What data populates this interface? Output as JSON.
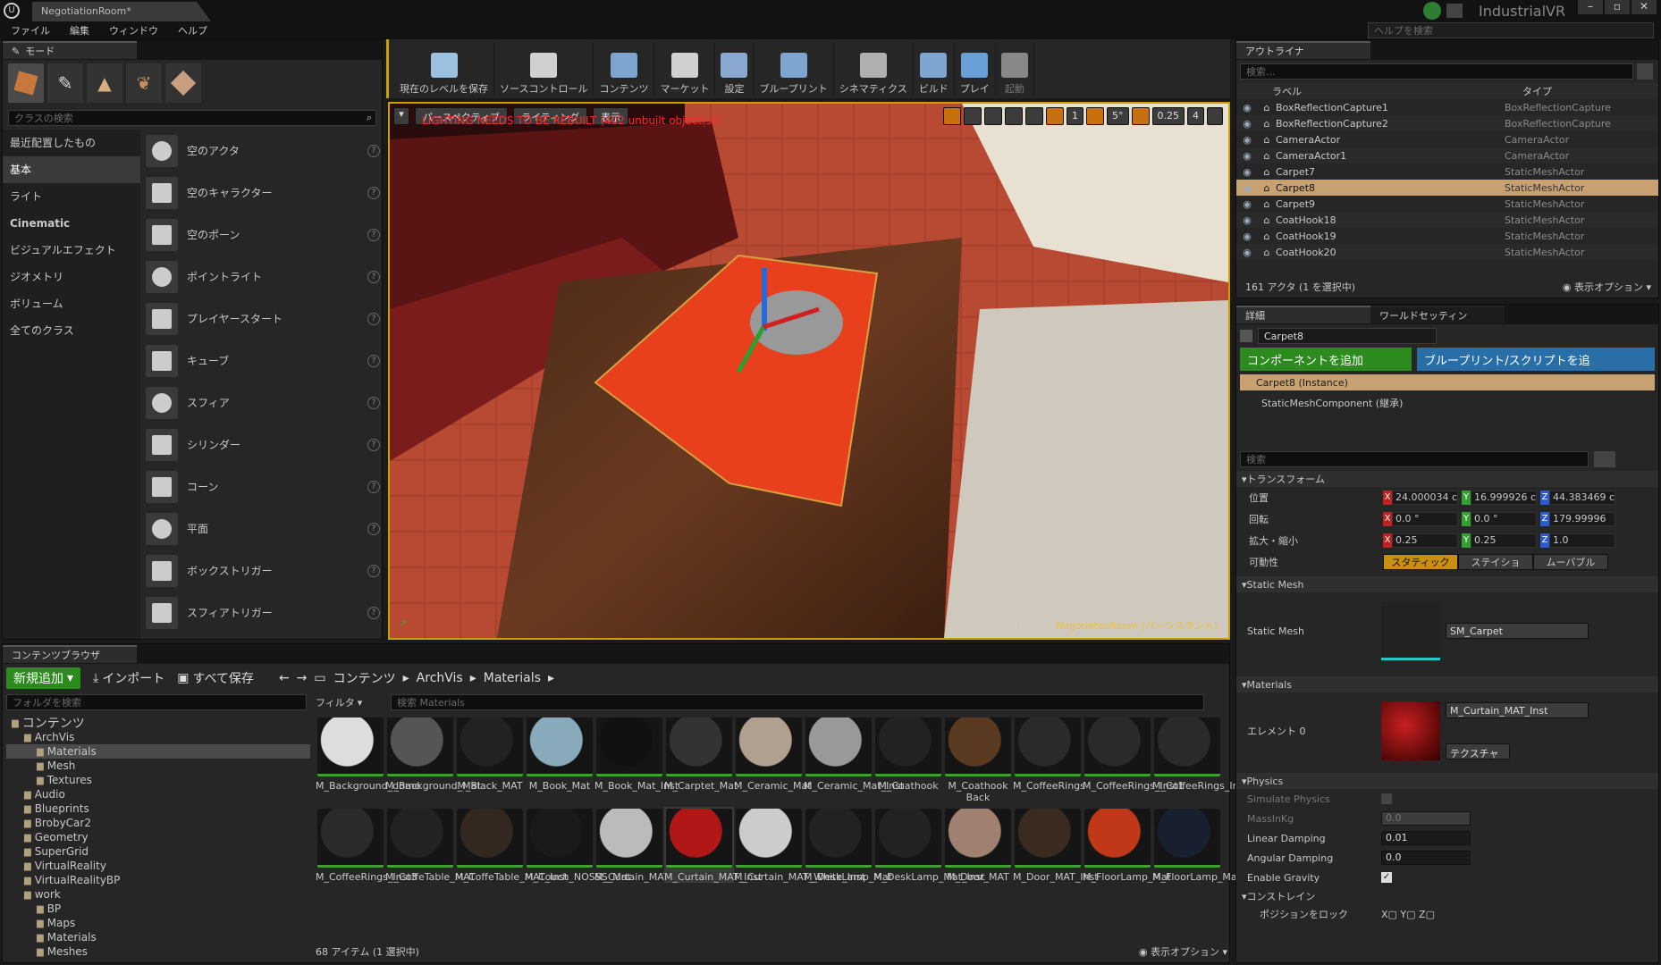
{
  "app": {
    "tab_title": "NegotiationRoom*",
    "brand": "IndustrialVR",
    "help_search_placeholder": "ヘルプを検索"
  },
  "menu": [
    "ファイル",
    "編集",
    "ウィンドウ",
    "ヘルプ"
  ],
  "modes": {
    "tab": "モード",
    "search_placeholder": "クラスの検索",
    "categories": [
      "最近配置したもの",
      "基本",
      "ライト",
      "Cinematic",
      "ビジュアルエフェクト",
      "ジオメトリ",
      "ボリューム",
      "全てのクラス"
    ],
    "selected_category": "基本",
    "items": [
      "空のアクタ",
      "空のキャラクター",
      "空のポーン",
      "ポイントライト",
      "プレイヤースタート",
      "キューブ",
      "スフィア",
      "シリンダー",
      "コーン",
      "平面",
      "ボックストリガー",
      "スフィアトリガー"
    ]
  },
  "toolbar": {
    "buttons": [
      "現在のレベルを保存",
      "ソースコントロール",
      "コンテンツ",
      "マーケット",
      "設定",
      "ブループリント",
      "シネマティクス",
      "ビルド",
      "プレイ",
      "起動"
    ]
  },
  "viewport": {
    "perspective": "パースペクティブ",
    "lighting": "ライティング",
    "show": "表示",
    "warning": "LIGHTING NEEDS TO BE REBUILT (402 unbuilt object(s))",
    "grid": "1",
    "angle": "5°",
    "scale": "0.25",
    "camera_speed": "4",
    "level_label": "レベル：",
    "level_name": "NegotiatonRoom (パーシスタント)"
  },
  "content_browser": {
    "tab": "コンテンツブラウザ",
    "add_new": "新規追加",
    "import": "インポート",
    "save_all": "すべて保存",
    "path": [
      "コンテンツ",
      "ArchVis",
      "Materials"
    ],
    "folder_search_placeholder": "フォルダを検索",
    "filter": "フィルタ",
    "asset_search_placeholder": "検索 Materials",
    "tree": [
      {
        "label": "コンテンツ",
        "level": 0,
        "root": true
      },
      {
        "label": "ArchVis",
        "level": 1
      },
      {
        "label": "Materials",
        "level": 2,
        "selected": true
      },
      {
        "label": "Mesh",
        "level": 2
      },
      {
        "label": "Textures",
        "level": 2
      },
      {
        "label": "Audio",
        "level": 1
      },
      {
        "label": "Blueprints",
        "level": 1
      },
      {
        "label": "BrobyCar2",
        "level": 1
      },
      {
        "label": "Geometry",
        "level": 1
      },
      {
        "label": "SuperGrid",
        "level": 1
      },
      {
        "label": "VirtualReality",
        "level": 1
      },
      {
        "label": "VirtualRealityBP",
        "level": 1
      },
      {
        "label": "work",
        "level": 1
      },
      {
        "label": "BP",
        "level": 2
      },
      {
        "label": "Maps",
        "level": 2
      },
      {
        "label": "Materials",
        "level": 2
      },
      {
        "label": "Meshes",
        "level": 2
      }
    ],
    "assets_row1": [
      "M_Background_dome",
      "M_Background_Mat",
      "M_Black_MAT",
      "M_Book_Mat",
      "M_Book_Mat_Inst",
      "M_Carptet_Mat",
      "M_Ceramic_Mat",
      "M_Ceramic_Mat_Inst",
      "M_Coathook",
      "M_Coathook Back",
      "M_CoffeeRings",
      "M_CoffeeRings_Inst1",
      "M_CoffeeRings_Inst2"
    ],
    "assets_row2": [
      "M_CoffeeRings_Inst3",
      "M_CoffeTable_MAT",
      "M_CoffeTable_MAT_Inst",
      "M_Couch_NOSSS_Mat",
      "M_Curtain_MAT",
      "M_Curtain_MAT_Inst",
      "M_Curtain_MAT_White_Inst",
      "M_DeskLamp_Mat",
      "M_DeskLamp_Mat_Inst",
      "M_Door_MAT",
      "M_Door_MAT_Inst",
      "M_FloorLamp_Mat",
      "M_FloorLamp_Mat_Inst"
    ],
    "selected_asset": "M_Curtain_MAT_Inst",
    "status": "68 アイテム (1 選択中)",
    "view_options": "表示オプション"
  },
  "outliner": {
    "tab": "アウトライナ",
    "search_placeholder": "検索...",
    "col_label": "ラベル",
    "col_type": "タイプ",
    "rows": [
      {
        "label": "BoxReflectionCapture1",
        "type": "BoxReflectionCapture"
      },
      {
        "label": "BoxReflectionCapture2",
        "type": "BoxReflectionCapture"
      },
      {
        "label": "CameraActor",
        "type": "CameraActor"
      },
      {
        "label": "CameraActor1",
        "type": "CameraActor"
      },
      {
        "label": "Carpet7",
        "type": "StaticMeshActor"
      },
      {
        "label": "Carpet8",
        "type": "StaticMeshActor",
        "selected": true
      },
      {
        "label": "Carpet9",
        "type": "StaticMeshActor"
      },
      {
        "label": "CoatHook18",
        "type": "StaticMeshActor"
      },
      {
        "label": "CoatHook19",
        "type": "StaticMeshActor"
      },
      {
        "label": "CoatHook20",
        "type": "StaticMeshActor"
      }
    ],
    "status": "161 アクタ (1 を選択中)",
    "view_options": "表示オプション"
  },
  "details": {
    "tab": "詳細",
    "tab2": "ワールドセッティン",
    "name": "Carpet8",
    "add_component": "コンポーネントを追加",
    "blueprint_script": "ブループリント/スクリプトを追",
    "instance": "Carpet8 (Instance)",
    "component": "StaticMeshComponent (継承)",
    "search_placeholder": "検索",
    "transform": {
      "section": "トランスフォーム",
      "location_label": "位置",
      "rotation_label": "回転",
      "scale_label": "拡大・縮小",
      "mobility_label": "可動性",
      "location": [
        "24.000034 c",
        "16.999926 c",
        "44.383469 c"
      ],
      "rotation": [
        "0.0 °",
        "0.0 °",
        "179.99996"
      ],
      "scale": [
        "0.25",
        "0.25",
        "1.0"
      ],
      "mobility": [
        "スタティック",
        "ステイショ",
        "ムーバブル"
      ]
    },
    "static_mesh": {
      "section": "Static Mesh",
      "label": "Static Mesh",
      "value": "SM_Carpet"
    },
    "materials": {
      "section": "Materials",
      "label": "エレメント 0",
      "value": "M_Curtain_MAT_Inst",
      "textures_btn": "テクスチャ"
    },
    "physics": {
      "section": "Physics",
      "simulate": "Simulate Physics",
      "mass": "MassInKg",
      "mass_value": "0.0",
      "linear": "Linear Damping",
      "linear_value": "0.01",
      "angular": "Angular Damping",
      "angular_value": "0.0",
      "gravity": "Enable Gravity",
      "constraints": "コンストレイン",
      "lock_position": "ポジションをロック"
    }
  },
  "colors": {
    "accent": "#2d8a1f",
    "selection": "#c8a170",
    "warning": "#ff2a2a",
    "blue_btn": "#2a6ea8"
  }
}
